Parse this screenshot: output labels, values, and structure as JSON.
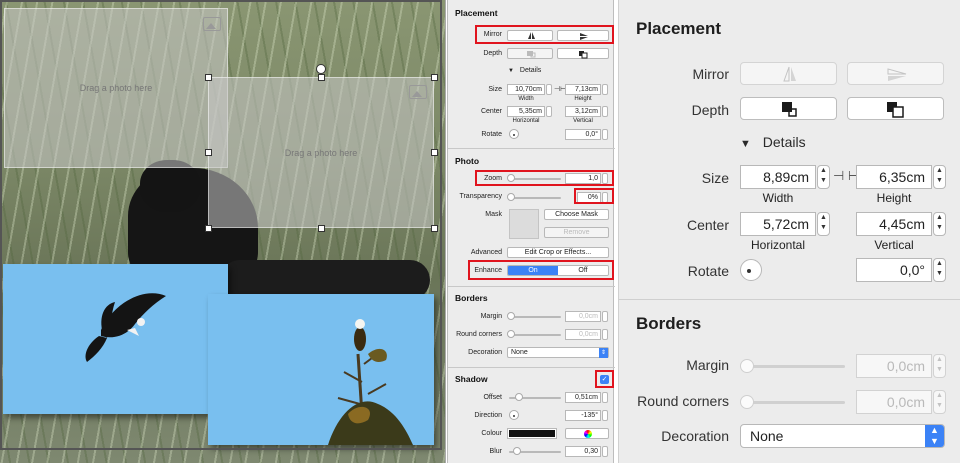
{
  "canvas": {
    "placeholder_text_1": "Drag a photo here",
    "placeholder_text_2": "Drag a photo here"
  },
  "inspector": {
    "placement": {
      "title": "Placement",
      "mirror_label": "Mirror",
      "depth_label": "Depth",
      "details_label": "Details",
      "size_label": "Size",
      "width_value": "10,70cm",
      "height_value": "7,13cm",
      "width_sub": "Width",
      "height_sub": "Height",
      "center_label": "Center",
      "horizontal_value": "5,35cm",
      "vertical_value": "3,12cm",
      "horizontal_sub": "Horizontal",
      "vertical_sub": "Vertical",
      "rotate_label": "Rotate",
      "rotate_value": "0,0°"
    },
    "photo": {
      "title": "Photo",
      "zoom_label": "Zoom",
      "zoom_value": "1,0",
      "transparency_label": "Transparency",
      "transparency_value": "0%",
      "mask_label": "Mask",
      "choose_mask": "Choose Mask",
      "remove": "Remove",
      "advanced_label": "Advanced",
      "edit_crop": "Edit Crop or Effects...",
      "enhance_label": "Enhance",
      "enhance_on": "On",
      "enhance_off": "Off"
    },
    "borders": {
      "title": "Borders",
      "margin_label": "Margin",
      "margin_value": "0,0cm",
      "round_label": "Round corners",
      "round_value": "0,0cm",
      "decoration_label": "Decoration",
      "decoration_value": "None"
    },
    "shadow": {
      "title": "Shadow",
      "checkbox_mark": "✓",
      "offset_label": "Offset",
      "offset_value": "0,51cm",
      "direction_label": "Direction",
      "direction_value": "-135°",
      "colour_label": "Colour",
      "blur_label": "Blur",
      "blur_value": "0,30"
    }
  },
  "zoom": {
    "placement_title": "Placement",
    "mirror_label": "Mirror",
    "depth_label": "Depth",
    "details_label": "Details",
    "size_label": "Size",
    "width_value": "8,89cm",
    "height_value": "6,35cm",
    "width_sub": "Width",
    "height_sub": "Height",
    "center_label": "Center",
    "horizontal_value": "5,72cm",
    "vertical_value": "4,45cm",
    "horizontal_sub": "Horizontal",
    "vertical_sub": "Vertical",
    "rotate_label": "Rotate",
    "rotate_value": "0,0°",
    "borders_title": "Borders",
    "margin_label": "Margin",
    "margin_value": "0,0cm",
    "round_label": "Round corners",
    "round_value": "0,0cm",
    "decoration_label": "Decoration",
    "decoration_value": "None"
  },
  "colors": {
    "highlight_red": "#e0141e",
    "accent_blue": "#3b82f6",
    "sky_blue": "#79bfef"
  }
}
